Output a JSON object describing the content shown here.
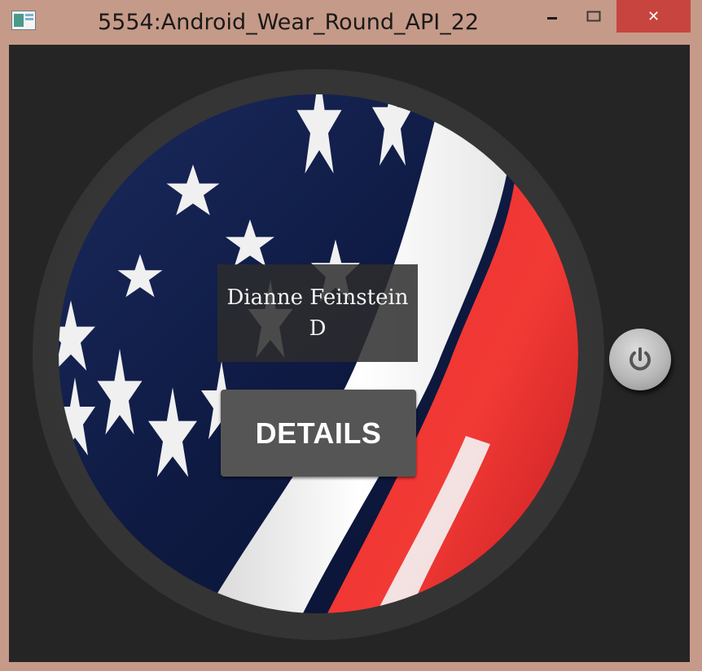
{
  "window": {
    "title": "5554:Android_Wear_Round_API_22",
    "close_glyph": "✕",
    "minimize_icon": "minimize-icon",
    "maximize_icon": "maximize-icon"
  },
  "watch": {
    "background_image": "american-flag",
    "senator_name": "Dianne Feinstein",
    "party": "D",
    "details_button_label": "DETAILS",
    "power_icon": "power-icon"
  },
  "colors": {
    "title_bar": "#c69a88",
    "close_button": "#c8443f",
    "content_background": "#252525",
    "details_button": "#555555"
  }
}
